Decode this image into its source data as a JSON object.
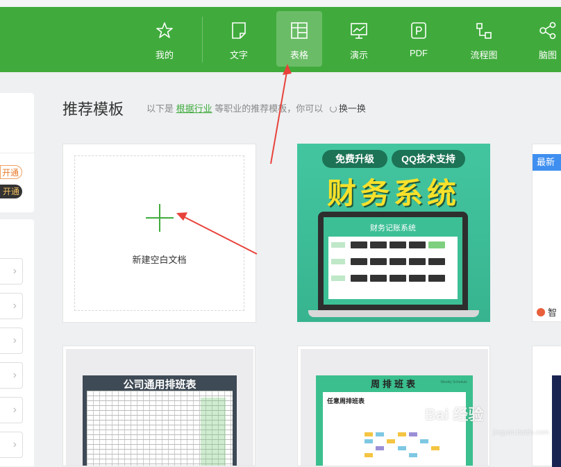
{
  "nav": {
    "items": [
      {
        "label": "我的",
        "icon": "star-icon"
      },
      {
        "label": "文字",
        "icon": "document-icon"
      },
      {
        "label": "表格",
        "icon": "table-icon",
        "active": true
      },
      {
        "label": "演示",
        "icon": "presentation-icon"
      },
      {
        "label": "PDF",
        "icon": "pdf-icon"
      },
      {
        "label": "流程图",
        "icon": "flowchart-icon"
      },
      {
        "label": "脑图",
        "icon": "mindmap-icon"
      }
    ],
    "color": "#40ab3c"
  },
  "sidebar": {
    "pill_outline": "开通",
    "pill_dark": "开通"
  },
  "section": {
    "title": "推荐模板",
    "desc_prefix": "以下是",
    "desc_link": "根据行业",
    "desc_suffix": "等职业的推荐模板，你可以",
    "swap_label": "换一换"
  },
  "blank_card": {
    "label": "新建空白文档"
  },
  "finance_template": {
    "tag_left": "免费升级",
    "tag_right": "QQ技术支持",
    "title": "财务系统",
    "screen_title": "财务记账系统"
  },
  "right_card": {
    "badge": "最新",
    "brand": "智"
  },
  "schedule1": {
    "title": "公司通用排班表"
  },
  "schedule2": {
    "title": "周排班表",
    "subtitle": "Weekly Schedule",
    "sheet_heading": "任意周排班表"
  },
  "watermark": {
    "main": "Bai 经验",
    "sub": "jingyan.baidu.com"
  }
}
